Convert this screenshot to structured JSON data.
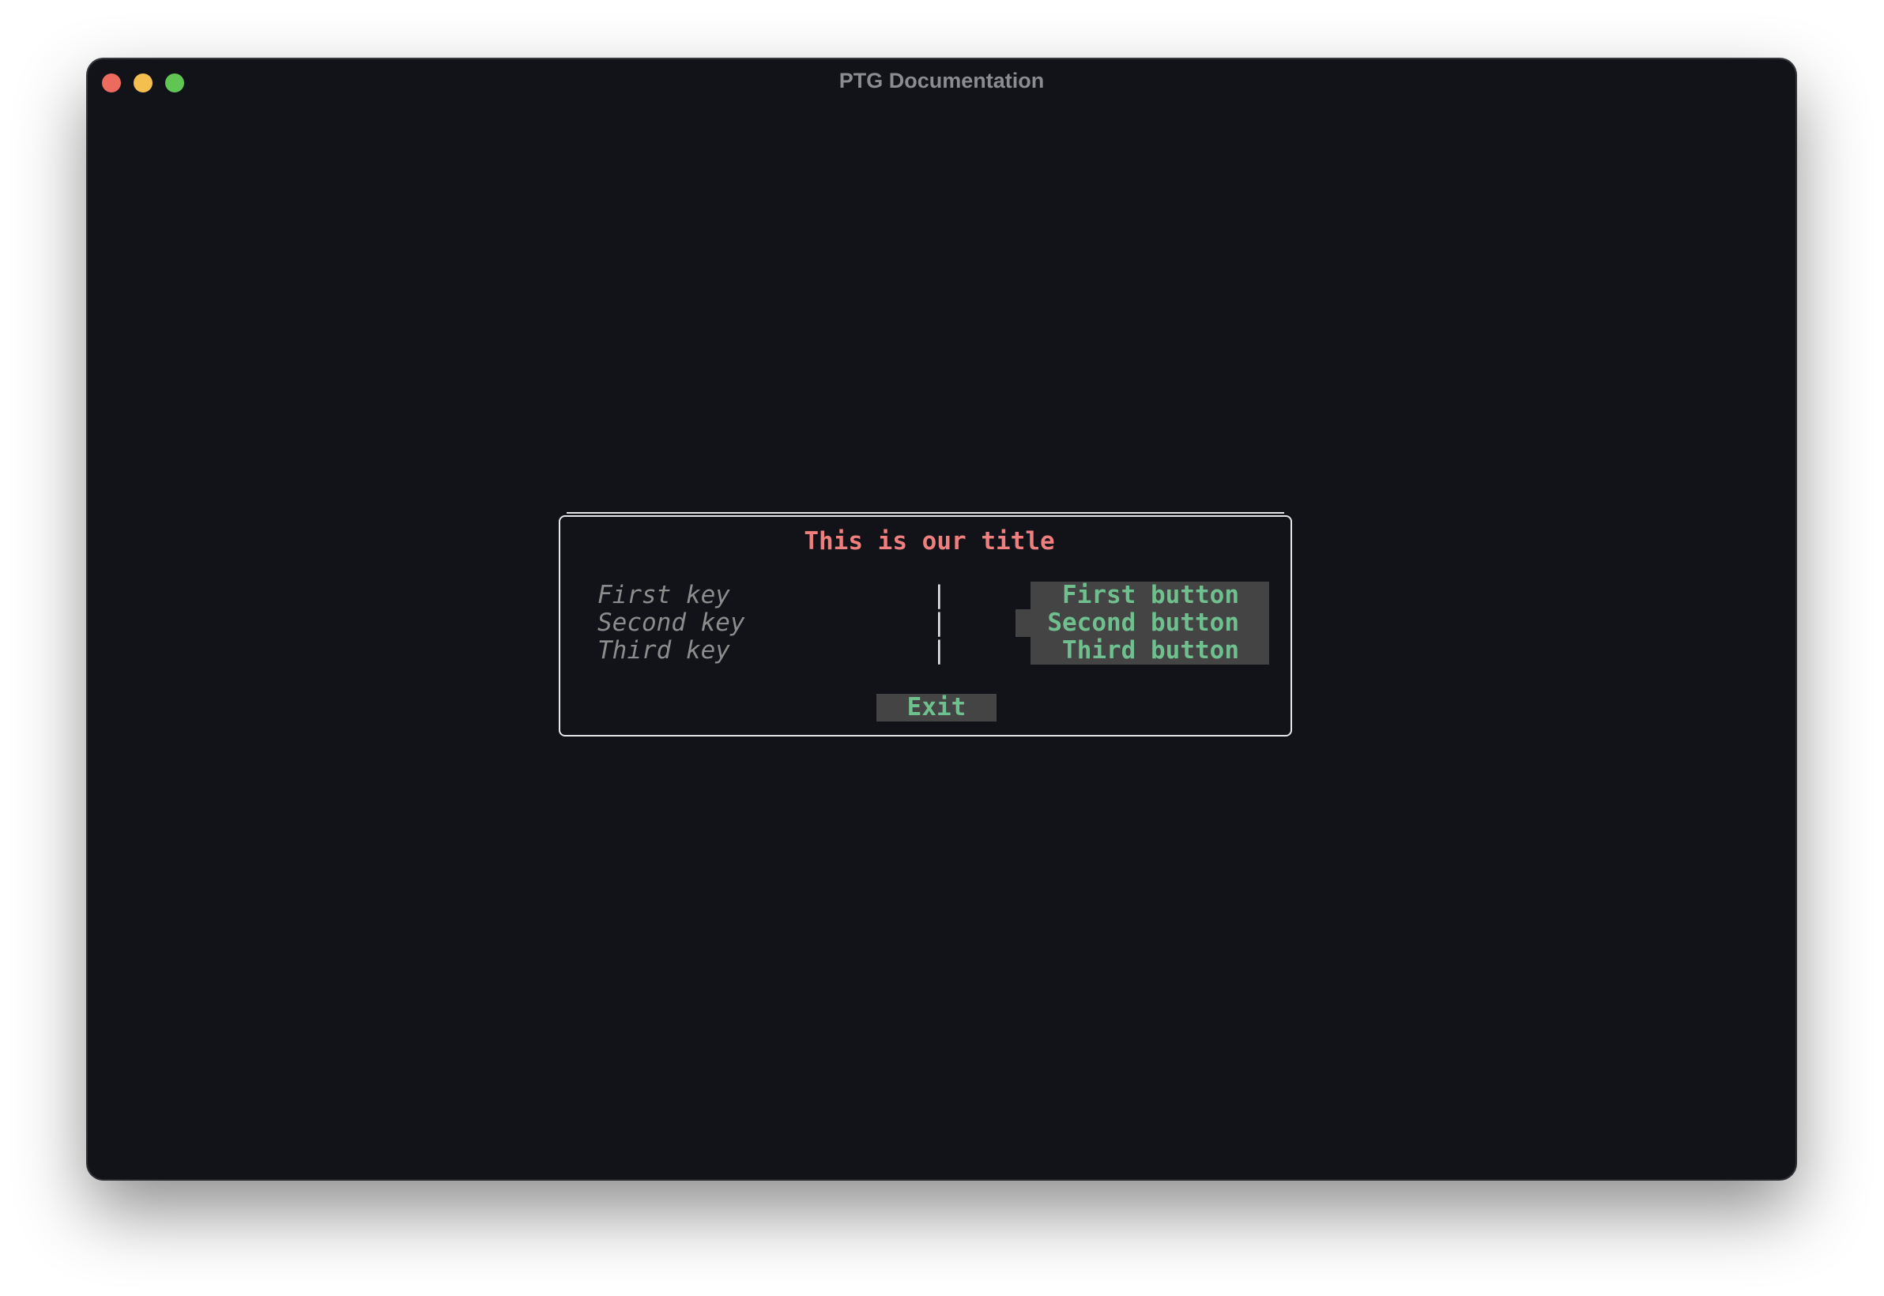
{
  "window": {
    "title": "PTG Documentation"
  },
  "dialog": {
    "title": "This is our title",
    "rows": [
      {
        "key": "First key",
        "separator": "|",
        "button": "First button"
      },
      {
        "key": "Second key",
        "separator": "|",
        "button": "Second button"
      },
      {
        "key": "Third key",
        "separator": "|",
        "button": "Third button"
      }
    ],
    "exit_label": "Exit"
  },
  "colors": {
    "background": "#111318",
    "title": "#ef7f7f",
    "key_text": "#8c8c8c",
    "button_text": "#6fbf8f",
    "button_bg": "#444444",
    "border": "#e6e6e6"
  }
}
